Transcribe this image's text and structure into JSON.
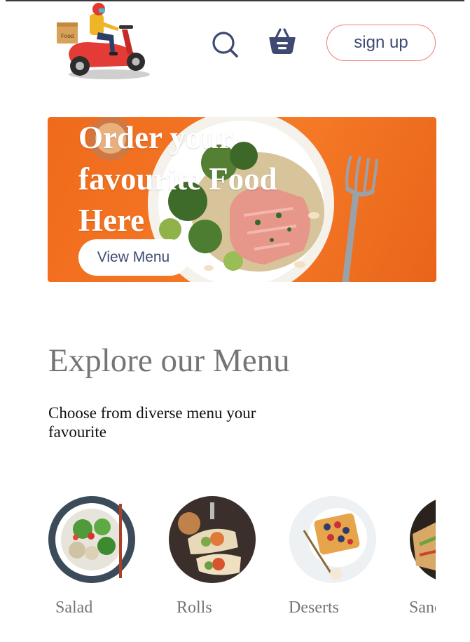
{
  "header": {
    "logo_icon": "delivery-scooter-icon",
    "logo_box_text": "Food",
    "search_icon": "search-icon",
    "basket_icon": "basket-icon",
    "signup_label": "sign up",
    "signup_border_color": "#f07e77",
    "text_color": "#3e4a72"
  },
  "hero": {
    "title": "Order your favourite Food Here",
    "button_label": "View Menu",
    "background_color": "#f27220"
  },
  "explore": {
    "title": "Explore our Menu",
    "subtitle": "Choose from diverse menu your favourite"
  },
  "categories": [
    {
      "label": "Salad",
      "icon": "salad-bowl-image"
    },
    {
      "label": "Rolls",
      "icon": "rolls-image"
    },
    {
      "label": "Deserts",
      "icon": "waffle-image"
    },
    {
      "label": "Sandwich",
      "icon": "sandwich-image"
    }
  ]
}
